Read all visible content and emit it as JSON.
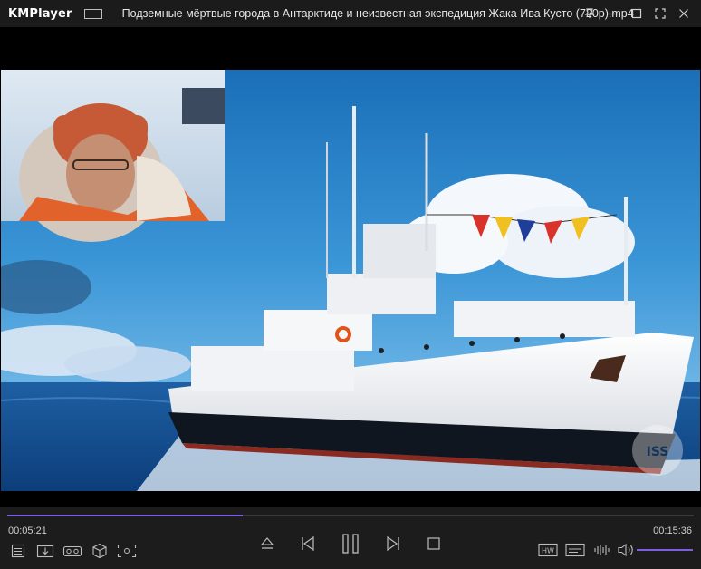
{
  "app": {
    "logo": "KMPlayer",
    "window_title": "Подземные мёртвые города в Антарктиде и неизвестная экспедиция Жака Ива Кусто (720p).mp4"
  },
  "title_bar_icons": [
    "skin-icon",
    "pin-icon",
    "minimize-icon",
    "maximize-icon",
    "fullscreen-icon",
    "close-icon"
  ],
  "video": {
    "watermark": "ISS"
  },
  "playback": {
    "current_time": "00:05:21",
    "total_time": "00:15:36",
    "progress": 0.343,
    "volume": 1.0
  },
  "controls": {
    "left": [
      "playlist-icon",
      "download-icon",
      "vr-icon",
      "3d-icon",
      "capture-icon"
    ],
    "center": [
      "eject-icon",
      "previous-icon",
      "pause-icon",
      "next-icon",
      "stop-icon"
    ],
    "right": [
      "hw-decoder-icon",
      "subtitle-icon",
      "equalizer-icon",
      "volume-icon"
    ],
    "hw_label": "HW"
  },
  "colors": {
    "accent": "#7b5fe0",
    "titlebar_bg": "#1b1b1b",
    "controls_bg": "#1c1c1c"
  }
}
